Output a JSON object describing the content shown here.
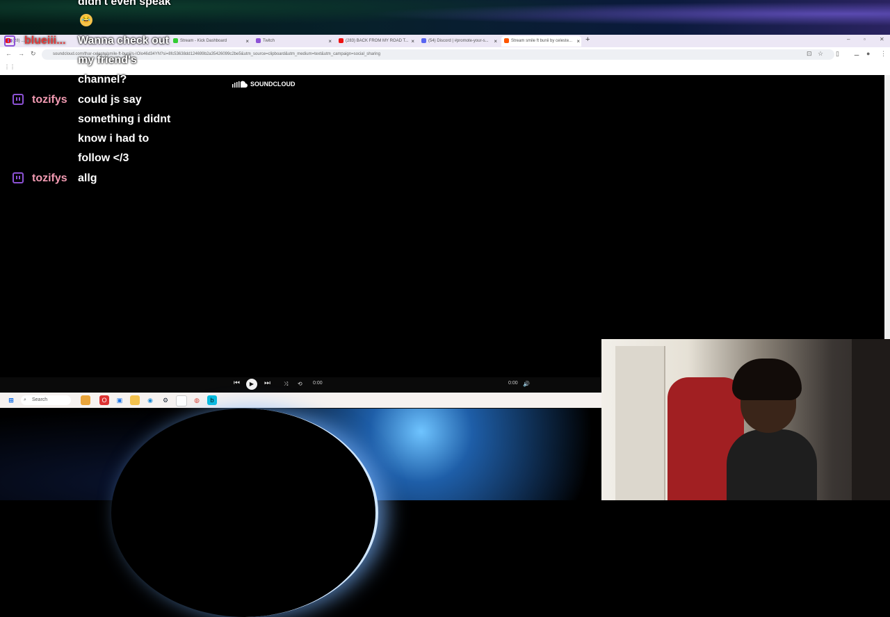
{
  "browser": {
    "tabs": [
      {
        "label": "(28) ...",
        "icon": "youtube-icon",
        "color": "#e11"
      },
      {
        "label": "Stream - Kick Dashboard",
        "icon": "kick-icon",
        "color": "#3c3"
      },
      {
        "label": "Twitch",
        "icon": "twitch-icon",
        "color": "#8d52d6"
      },
      {
        "label": "(283) BACK FROM MY ROAD T...",
        "icon": "youtube-icon",
        "color": "#e11"
      },
      {
        "label": "(54) Discord | #promote-your-s...",
        "icon": "discord-icon",
        "color": "#5865f2"
      },
      {
        "label": "Stream smile ft bunii by celeste...",
        "icon": "soundcloud-icon",
        "color": "#f50"
      }
    ],
    "url": "soundcloud.com/thar-celeste/smile-ft-bunii/s-IOlo46d34YN?si=8fc53638dd124699b2a35426099c2be5&utm_source=clipboard&utm_medium=text&utm_campaign=social_sharing"
  },
  "soundcloud": {
    "logo_text": "SOUNDCLOUD"
  },
  "player": {
    "time_current": "0:00",
    "time_total": "0:00"
  },
  "taskbar": {
    "search_placeholder": "Search"
  },
  "chat": {
    "lines": [
      {
        "text": "didn't even speak"
      },
      {
        "text": "Wanna check out"
      },
      {
        "text": "my friend's"
      },
      {
        "text": "channel?"
      },
      {
        "text": "could js say"
      },
      {
        "text": "something i didnt"
      },
      {
        "text": "know i had to"
      },
      {
        "text": "follow </3"
      },
      {
        "text": "allg"
      }
    ],
    "users": [
      {
        "name": "blueiii..."
      },
      {
        "name": "tozifys"
      },
      {
        "name": "tozifys"
      }
    ],
    "colors": {
      "username": "#f39bb3",
      "blueiii": "#e23b3b",
      "badge": "#8d52d6"
    }
  }
}
